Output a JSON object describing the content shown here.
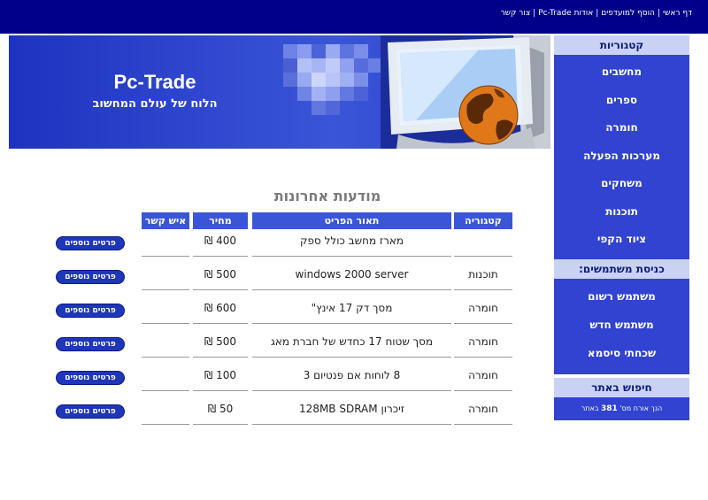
{
  "top_nav": {
    "links": [
      "דף ראשי",
      "הוסף למועדפים",
      "אודות Pc-Trade",
      "צור קשר"
    ],
    "separator": "|"
  },
  "banner": {
    "title": "Pc-Trade",
    "subtitle": "הלוח של עולם המחשוב"
  },
  "sidebar": {
    "categories_header": "קטגוריות",
    "categories": [
      "מחשבים",
      "ספרים",
      "חומרה",
      "מערכות הפעלה",
      "משחקים",
      "תוכנות",
      "ציוד הקפי"
    ],
    "login_header": "כניסת משתמשים:",
    "login_items": [
      "משתמש רשום",
      "משתמש חדש",
      "שכחתי סיסמא"
    ],
    "search_header": "חיפוש באתר",
    "visitor_prefix": "הנך אורח מס'",
    "visitor_number": "381",
    "visitor_suffix": "באתר"
  },
  "main": {
    "title": "מודעות אחרונות",
    "columns": {
      "category": "קטגוריה",
      "description": "תאור הפריט",
      "price": "מחיר",
      "contact": "איש קשר"
    },
    "more_details_label": "פרטים נוספים",
    "rows": [
      {
        "category": "",
        "description": "מארז מחשב כולל ספק",
        "price": "400 ₪"
      },
      {
        "category": "תוכנות",
        "description": "windows 2000 server",
        "price": "500 ₪"
      },
      {
        "category": "חומרה",
        "description": "מסך דק 17 אינץ\"",
        "price": "600 ₪"
      },
      {
        "category": "חומרה",
        "description": "מסך שטוח 17 כחדש של חברת מאג",
        "price": "500 ₪"
      },
      {
        "category": "חומרה",
        "description": "8 לוחות אם פנטיום 3",
        "price": "100 ₪"
      },
      {
        "category": "חומרה",
        "description": "זיכרון 128MB SDRAM",
        "price": "50 ₪"
      }
    ]
  }
}
